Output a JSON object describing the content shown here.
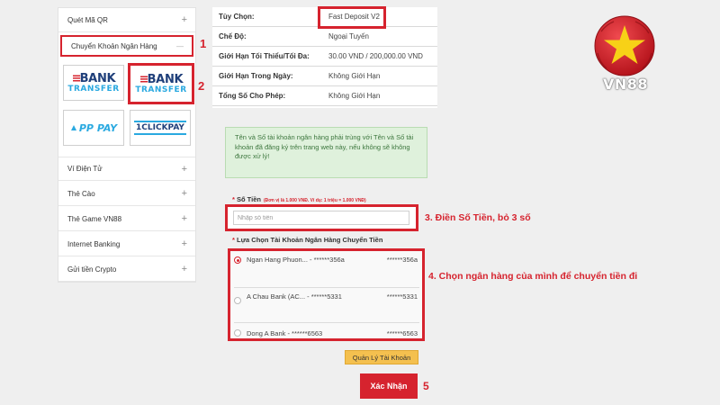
{
  "sidebar": {
    "items": [
      {
        "label": "Quét Mã QR",
        "icon": "plus-icon"
      },
      {
        "label": "Chuyển Khoản Ngân Hàng",
        "icon": "minus-icon"
      },
      {
        "label": "Ví Điện Tử",
        "icon": "plus-icon"
      },
      {
        "label": "Thẻ Cào",
        "icon": "plus-icon"
      },
      {
        "label": "Thẻ Game VN88",
        "icon": "plus-icon"
      },
      {
        "label": "Internet Banking",
        "icon": "plus-icon"
      },
      {
        "label": "Gửi tiền Crypto",
        "icon": "plus-icon"
      }
    ],
    "plus_glyph": "+",
    "minus_glyph": "—",
    "payment_options": [
      {
        "line1": "BANK",
        "line2": "TRANSFER",
        "selected": false
      },
      {
        "line1": "BANK",
        "line2": "TRANSFER",
        "selected": true
      },
      {
        "label": "PP PAY"
      },
      {
        "label": "1CLICKPAY"
      }
    ]
  },
  "info": {
    "rows": [
      {
        "label": "Tùy Chọn:",
        "value": "Fast Deposit V2"
      },
      {
        "label": "Chế Độ:",
        "value": "Ngoại Tuyến"
      },
      {
        "label": "Giới Hạn Tối Thiểu/Tối Đa:",
        "value": "30.00 VND / 200,000.00 VND"
      },
      {
        "label": "Giới Hạn Trong Ngày:",
        "value": "Không Giới Hạn"
      },
      {
        "label": "Tổng Số Cho Phép:",
        "value": "Không Giới Hạn"
      }
    ]
  },
  "notice": "Tên và Số tài khoản ngân hàng phải trùng với Tên và Số tài khoản đã đăng ký trên trang web này, nếu không sẽ không được xử lý!",
  "amount": {
    "label": "Số Tiền",
    "hint": "(Đơn vị là 1.000 VNĐ. Ví dụ: 1 triệu = 1.000 VNĐ)",
    "placeholder": "Nhập số tiền"
  },
  "bank_select": {
    "label": "Lựa Chọn Tài Khoản Ngân Hàng Chuyển Tiền",
    "accounts": [
      {
        "name": "Ngan Hang Phuon... - ******356a",
        "account": "******356a",
        "checked": true
      },
      {
        "name": "A Chau Bank (AC... - ******5331",
        "account": "******5331",
        "checked": false
      },
      {
        "name": "Dong A Bank - ******6563",
        "account": "******6563",
        "checked": false
      }
    ]
  },
  "buttons": {
    "manage": "Quản Lý Tài Khoản",
    "submit": "Xác Nhận"
  },
  "callouts": {
    "c1": "1",
    "c2": "2",
    "c3": "3. Điền Số Tiền, bỏ 3 số",
    "c4": "4. Chọn ngân hàng của mình để chuyển tiền đi",
    "c5": "5"
  },
  "logo": {
    "text": "VN88",
    "colors": {
      "red": "#d6232e",
      "yellow": "#f7d117"
    }
  }
}
